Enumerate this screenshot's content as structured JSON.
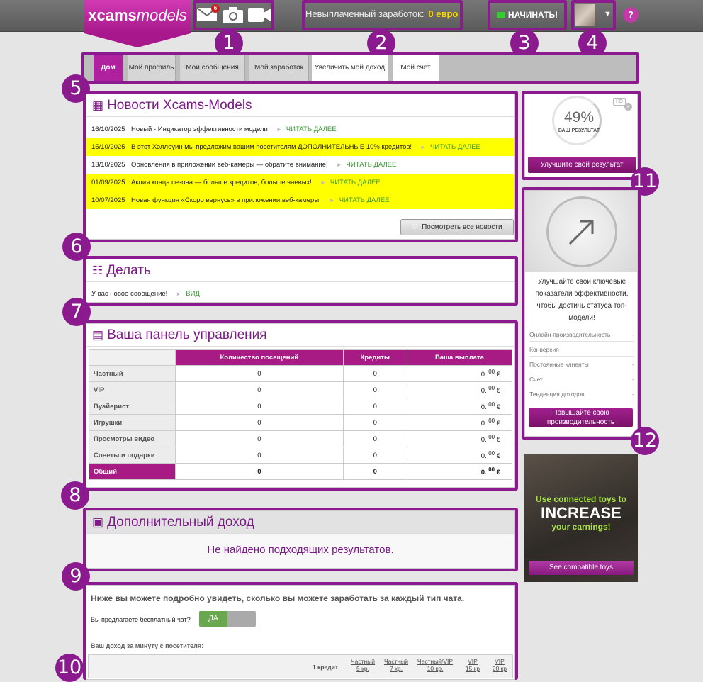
{
  "header": {
    "logo_a": "xcams",
    "logo_b": "models",
    "mail_badge": "6",
    "unpaid_label": "Невыплаченный заработок:",
    "unpaid_value": "0 евро",
    "start_label": "НАЧИНАТЬ!",
    "help": "?"
  },
  "callouts": [
    "1",
    "2",
    "3",
    "4",
    "5",
    "6",
    "7",
    "8",
    "9",
    "10",
    "11",
    "12"
  ],
  "nav": {
    "tabs": [
      "Дом",
      "Мой профиль",
      "Мои сообщения",
      "Мой заработок",
      "Увеличить мой доход",
      "Мой счет"
    ]
  },
  "news": {
    "title": "Новости Xcams-Models",
    "read_more": "ЧИТАТЬ ДАЛЕЕ",
    "items": [
      {
        "date": "16/10/2025",
        "text": "Новый - Индикатор эффективности модели"
      },
      {
        "date": "15/10/2025",
        "text": "В этот Хэллоуин мы предложим вашим посетителям ДОПОЛНИТЕЛЬНЫЕ 10% кредитов!"
      },
      {
        "date": "13/10/2025",
        "text": "Обновления в приложении веб-камеры — обратите внимание!"
      },
      {
        "date": "01/09/2025",
        "text": "Акция конца сезона — больше кредитов, больше чаевых!"
      },
      {
        "date": "10/07/2025",
        "text": "Новая функция «Скоро вернусь» в приложении веб-камеры."
      }
    ],
    "all_news": "Посмотреть все новости"
  },
  "todo": {
    "title": "Делать",
    "text": "У вас новое сообщение!",
    "link": "ВИД"
  },
  "dashboard": {
    "title": "Ваша панель управления",
    "cols": [
      "Количество посещений",
      "Кредиты",
      "Ваша выплата"
    ],
    "rows": [
      {
        "label": "Частный",
        "visits": "0",
        "credits": "0",
        "pay": "0."
      },
      {
        "label": "VIP",
        "visits": "0",
        "credits": "0",
        "pay": "0."
      },
      {
        "label": "Вуайерист",
        "visits": "0",
        "credits": "0",
        "pay": "0."
      },
      {
        "label": "Игрушки",
        "visits": "0",
        "credits": "0",
        "pay": "0."
      },
      {
        "label": "Просмотры видео",
        "visits": "0",
        "credits": "0",
        "pay": "0."
      },
      {
        "label": "Советы и подарки",
        "visits": "0",
        "credits": "0",
        "pay": "0."
      },
      {
        "label": "Общий",
        "visits": "0",
        "credits": "0",
        "pay": "0."
      }
    ],
    "cents": "00",
    "currency": "€"
  },
  "extra": {
    "title": "Дополнительный доход",
    "empty": "Не найдено подходящих результатов."
  },
  "earnings": {
    "intro": "Ниже вы можете подробно увидеть, сколько вы можете заработать за каждый тип чата.",
    "free_chat_q": "Вы предлагаете бесплатный чат?",
    "yes": "ДА",
    "per_min": "Ваш доход за минуту с посетителя:",
    "cols": [
      {
        "a": "1 кредит",
        "b": ""
      },
      {
        "a": "Частный",
        "b": "5 кр."
      },
      {
        "a": "Частный",
        "b": "7 кр."
      },
      {
        "a": "Частный/VIP",
        "b": "10 кр."
      },
      {
        "a": "VIP",
        "b": "15 кр"
      },
      {
        "a": "VIP",
        "b": "20 кр"
      }
    ]
  },
  "score": {
    "percent": "49%",
    "label": "ВАШ РЕЗУЛЬТАТ",
    "hd": "HD",
    "button": "Улучшите свой результат"
  },
  "perf": {
    "text": "Улучшайте свои ключевые показатели эффективности, чтобы достичь статуса топ-модели!",
    "kpis": [
      {
        "name": "Онлайн-производительность",
        "value": "-"
      },
      {
        "name": "Конверсия",
        "value": "-"
      },
      {
        "name": "Постоянные клиенты",
        "value": "-"
      },
      {
        "name": "Счет",
        "value": "-"
      },
      {
        "name": "Тенденция доходов",
        "value": "-"
      }
    ],
    "button": "Повышайте свою производительность"
  },
  "ad": {
    "line1": "Use connected toys to",
    "line2": "INCREASE",
    "line3": "your earnings!",
    "button": "See compatible toys"
  }
}
